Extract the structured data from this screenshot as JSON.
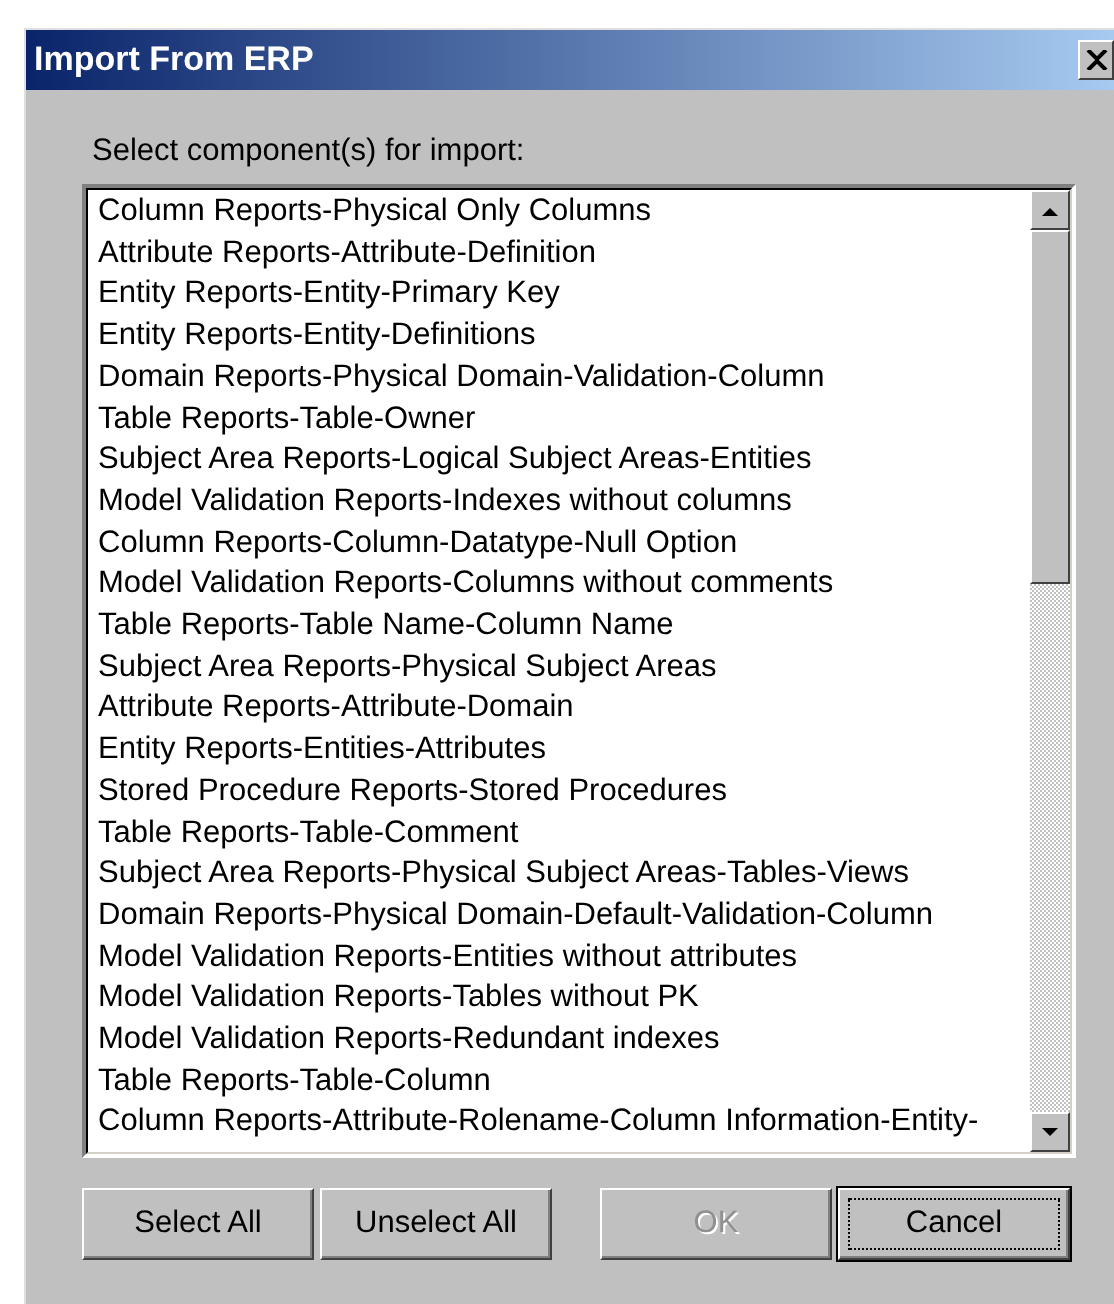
{
  "window": {
    "title": "Import From ERP"
  },
  "prompt": "Select component(s) for import:",
  "components": [
    "Column Reports-Physical Only Columns",
    "Attribute Reports-Attribute-Definition",
    "Entity Reports-Entity-Primary Key",
    "Entity Reports-Entity-Definitions",
    "Domain Reports-Physical Domain-Validation-Column",
    "Table Reports-Table-Owner",
    "Subject Area Reports-Logical Subject Areas-Entities",
    "Model Validation Reports-Indexes without columns",
    "Column Reports-Column-Datatype-Null Option",
    "Model Validation Reports-Columns without comments",
    "Table Reports-Table Name-Column Name",
    "Subject Area Reports-Physical Subject Areas",
    "Attribute Reports-Attribute-Domain",
    "Entity Reports-Entities-Attributes",
    "Stored Procedure Reports-Stored Procedures",
    "Table Reports-Table-Comment",
    "Subject Area Reports-Physical Subject Areas-Tables-Views",
    "Domain Reports-Physical Domain-Default-Validation-Column",
    "Model Validation Reports-Entities without attributes",
    "Model Validation Reports-Tables without PK",
    "Model Validation Reports-Redundant indexes",
    "Table Reports-Table-Column",
    "Column Reports-Attribute-Rolename-Column Information-Entity-"
  ],
  "buttons": [
    {
      "label": "Select All",
      "disabled": false,
      "default": false
    },
    {
      "label": "Unselect All",
      "disabled": false,
      "default": false
    },
    {
      "label": "OK",
      "disabled": true,
      "default": false
    },
    {
      "label": "Cancel",
      "disabled": false,
      "default": true
    }
  ]
}
